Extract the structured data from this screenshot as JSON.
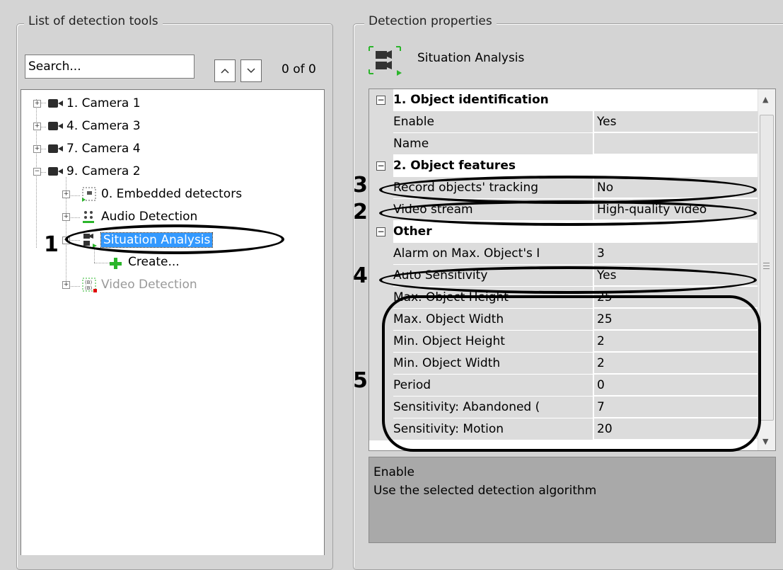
{
  "left_panel": {
    "title": "List of detection tools",
    "search": {
      "value": "Search...",
      "count": "0 of 0"
    },
    "tree": [
      {
        "label": "1. Camera 1",
        "expanded": false
      },
      {
        "label": "4. Camera 3",
        "expanded": false
      },
      {
        "label": "7. Camera 4",
        "expanded": false
      },
      {
        "label": "9. Camera 2",
        "expanded": true
      },
      {
        "label": "0. Embedded detectors"
      },
      {
        "label": "Audio Detection"
      },
      {
        "label": "Situation Analysis",
        "selected": true
      },
      {
        "label": "Create..."
      },
      {
        "label": "Video Detection",
        "disabled": true
      }
    ]
  },
  "right_panel": {
    "title": "Detection properties",
    "header": "Situation Analysis",
    "rows": [
      {
        "type": "category",
        "name": "1. Object identification",
        "toggle": "⊟"
      },
      {
        "type": "prop",
        "name": "Enable",
        "value": "Yes"
      },
      {
        "type": "prop",
        "name": "Name",
        "value": ""
      },
      {
        "type": "category",
        "name": "2. Object features",
        "toggle": "⊟"
      },
      {
        "type": "prop",
        "name": "Record objects' tracking",
        "value": "No"
      },
      {
        "type": "prop",
        "name": "Video stream",
        "value": "High-quality video"
      },
      {
        "type": "category",
        "name": "Other",
        "toggle": "⊟"
      },
      {
        "type": "prop",
        "name": "Alarm on Max. Object's I",
        "value": "3"
      },
      {
        "type": "prop",
        "name": "Auto Sensitivity",
        "value": "Yes"
      },
      {
        "type": "prop",
        "name": "Max. Object Height",
        "value": "25"
      },
      {
        "type": "prop",
        "name": "Max. Object Width",
        "value": "25"
      },
      {
        "type": "prop",
        "name": "Min. Object Height",
        "value": "2"
      },
      {
        "type": "prop",
        "name": "Min. Object Width",
        "value": "2"
      },
      {
        "type": "prop",
        "name": "Period",
        "value": "0"
      },
      {
        "type": "prop",
        "name": "Sensitivity: Abandoned (",
        "value": "7"
      },
      {
        "type": "prop",
        "name": "Sensitivity: Motion",
        "value": "20"
      }
    ],
    "description": {
      "title": "Enable",
      "text": "Use the selected detection algorithm"
    }
  },
  "annotations": {
    "n1": "1",
    "n2": "2",
    "n3": "3",
    "n4": "4",
    "n5": "5"
  },
  "colors": {
    "selection": "#3399ff",
    "window_bg": "#d4d4d4",
    "property_bg": "#dcdcdc",
    "description_bg": "#a9a9a9",
    "add_icon": "#2bb52b",
    "alert_icon": "#e00000"
  },
  "icons": [
    "camera-icon",
    "embedded-detectors-icon",
    "audio-detection-icon",
    "situation-analysis-icon",
    "add-icon",
    "video-detection-icon",
    "collapse-icon",
    "expand-icon",
    "arrow-up-icon",
    "arrow-down-icon"
  ]
}
